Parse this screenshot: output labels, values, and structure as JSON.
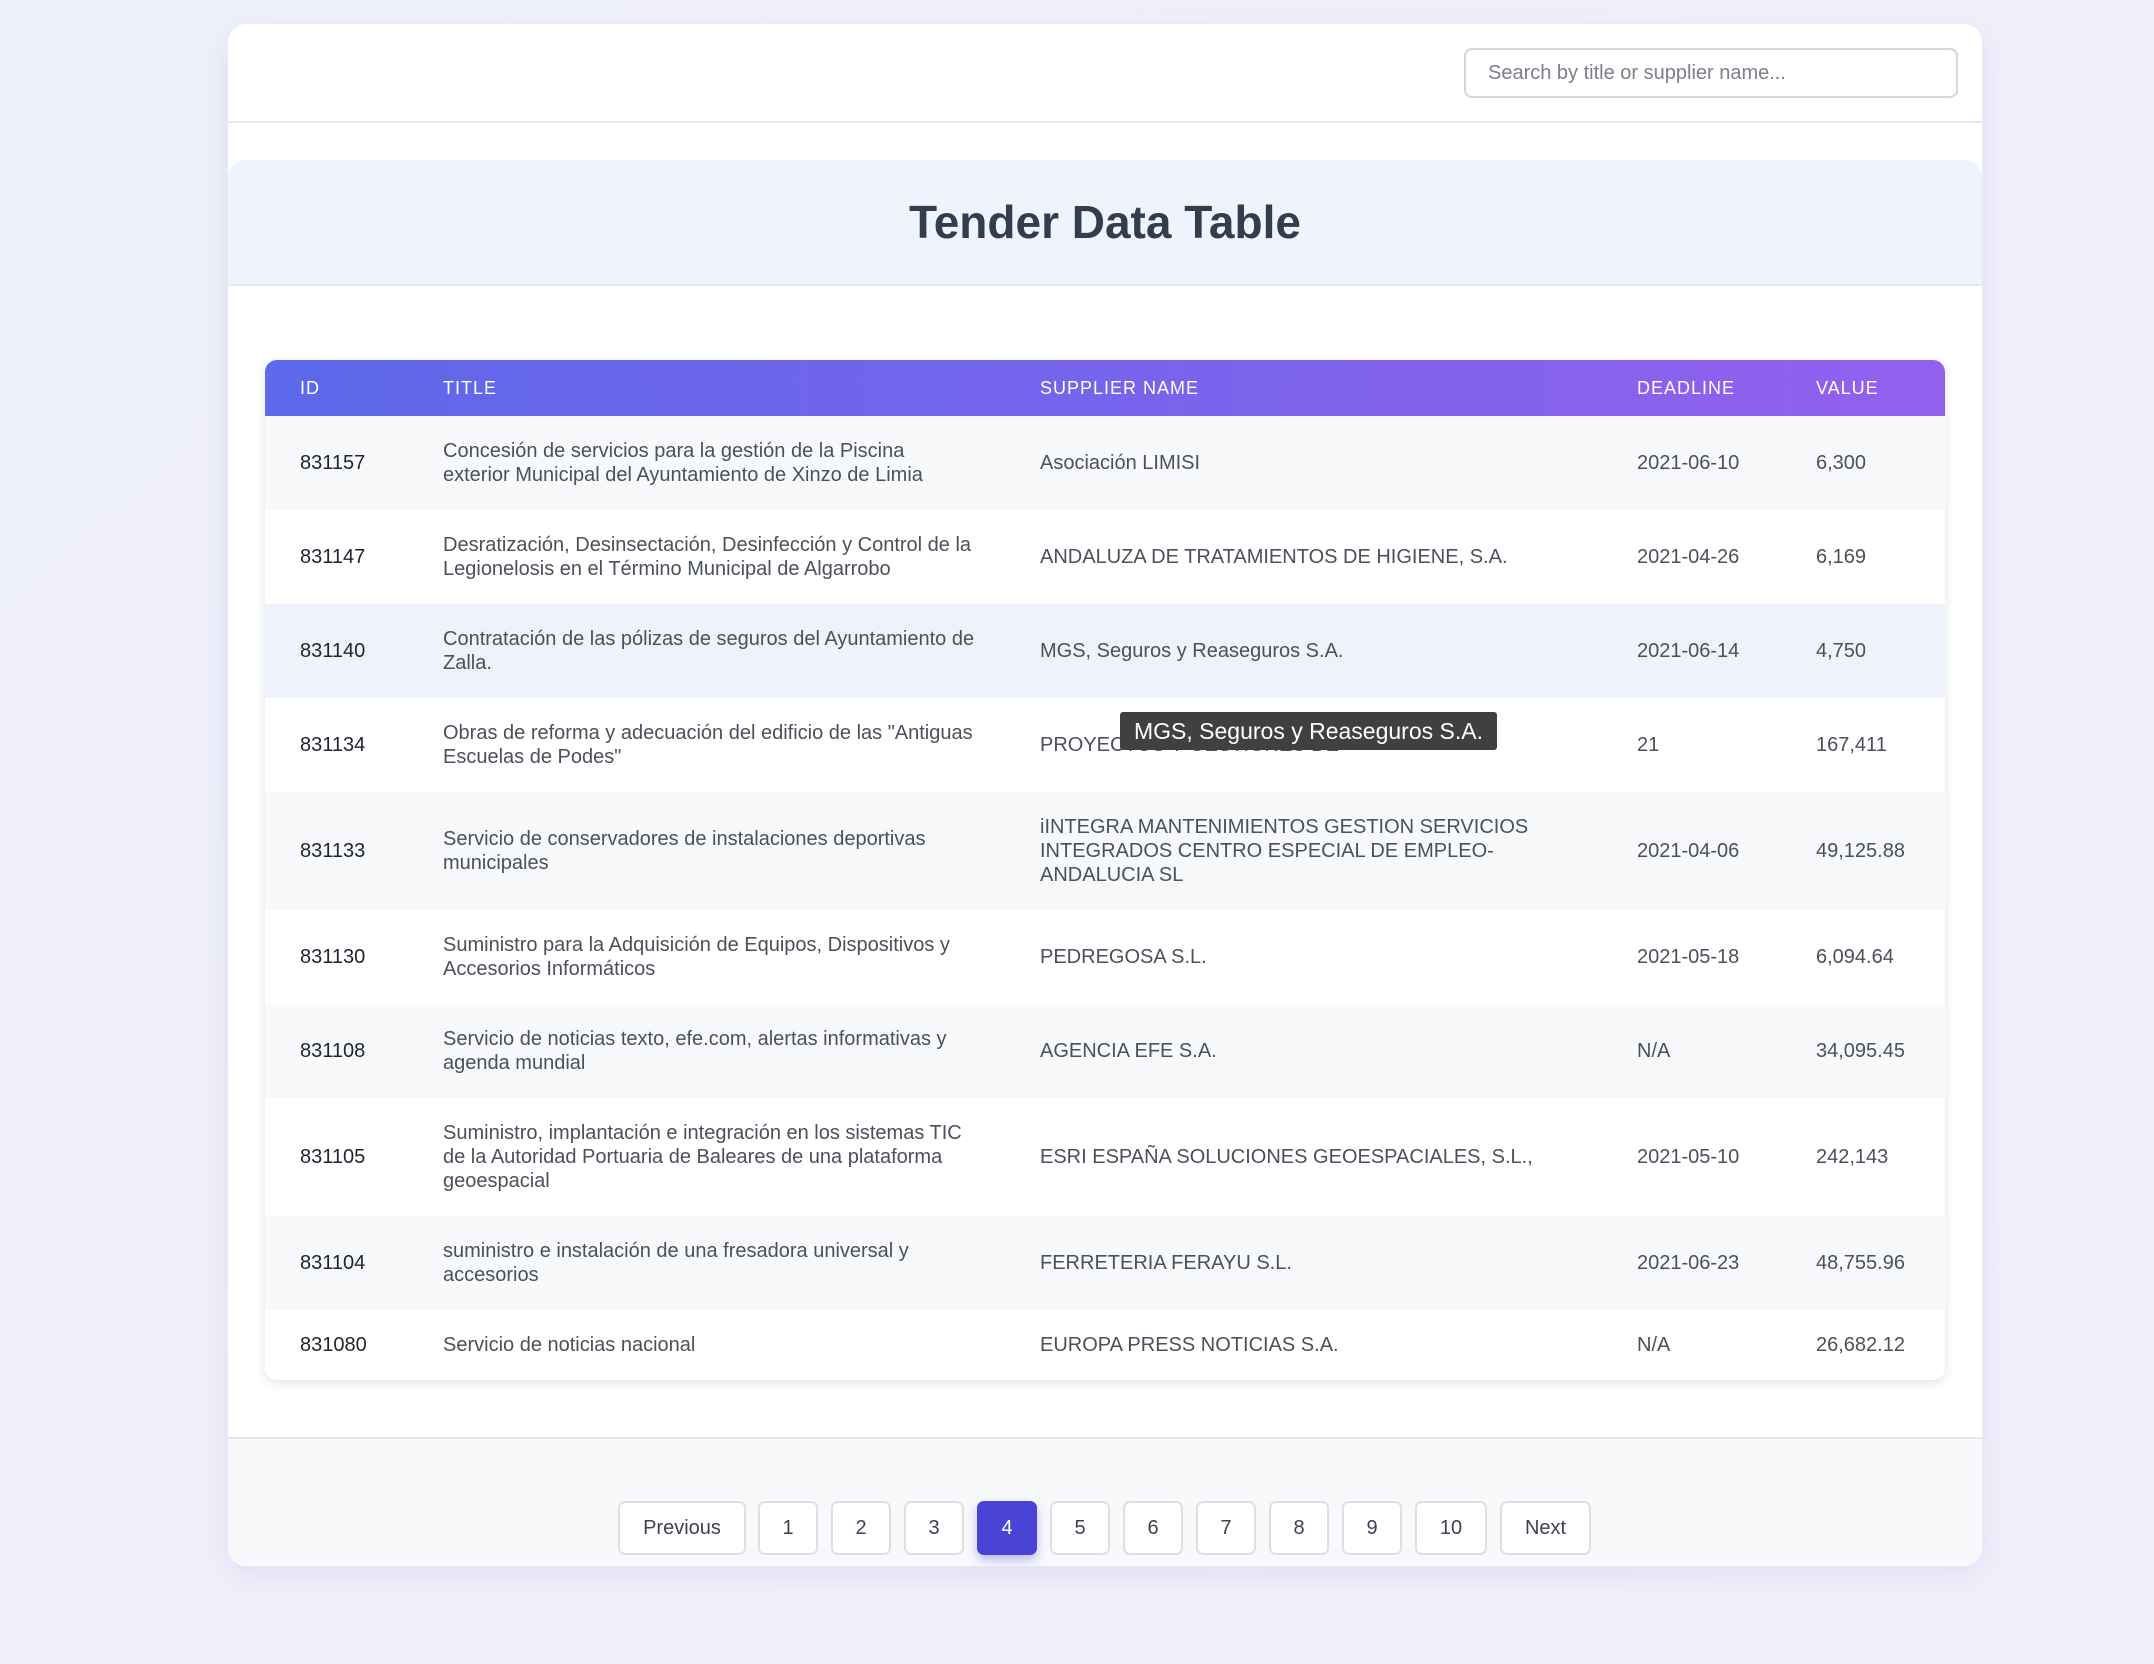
{
  "search": {
    "placeholder": "Search by title or supplier name..."
  },
  "page_title": "Tender Data Table",
  "table": {
    "headers": [
      "ID",
      "TITLE",
      "SUPPLIER NAME",
      "DEADLINE",
      "VALUE"
    ],
    "rows": [
      {
        "id": "831157",
        "title": "Concesión de servicios para la gestión de la Piscina exterior Municipal del Ayuntamiento de Xinzo de Limia",
        "supplier": "Asociación LIMISI",
        "deadline": "2021-06-10",
        "value": "6,300"
      },
      {
        "id": "831147",
        "title": "Desratización, Desinsectación, Desinfección y Control de la Legionelosis en el Término Municipal de Algarrobo",
        "supplier": "ANDALUZA DE TRATAMIENTOS DE HIGIENE, S.A.",
        "deadline": "2021-04-26",
        "value": "6,169"
      },
      {
        "id": "831140",
        "title": "Contratación de las pólizas de seguros del Ayuntamiento de Zalla.",
        "supplier": "MGS, Seguros y Reaseguros S.A.",
        "deadline": "2021-06-14",
        "value": "4,750"
      },
      {
        "id": "831134",
        "title": "Obras de reforma y adecuación del edificio de las \"Antiguas Escuelas de Podes\"",
        "supplier": "PROYECTOS Y GESTIONES DE",
        "deadline": "21",
        "value": "167,411"
      },
      {
        "id": "831133",
        "title": "Servicio de conservadores de instalaciones deportivas municipales",
        "supplier": "iINTEGRA MANTENIMIENTOS GESTION SERVICIOS INTEGRADOS CENTRO ESPECIAL DE EMPLEO-ANDALUCIA SL",
        "deadline": "2021-04-06",
        "value": "49,125.88"
      },
      {
        "id": "831130",
        "title": "Suministro para la Adquisición de Equipos, Dispositivos y Accesorios Informáticos",
        "supplier": "PEDREGOSA S.L.",
        "deadline": "2021-05-18",
        "value": "6,094.64"
      },
      {
        "id": "831108",
        "title": "Servicio de noticias texto, efe.com, alertas informativas y agenda mundial",
        "supplier": "AGENCIA EFE S.A.",
        "deadline": "N/A",
        "value": "34,095.45"
      },
      {
        "id": "831105",
        "title": "Suministro, implantación e integración en los sistemas TIC de la Autoridad Portuaria de Baleares de una plataforma geoespacial",
        "supplier": "ESRI ESPAÑA SOLUCIONES GEOESPACIALES, S.L.,",
        "deadline": "2021-05-10",
        "value": "242,143"
      },
      {
        "id": "831104",
        "title": "suministro e instalación de una fresadora universal y accesorios",
        "supplier": "FERRETERIA FERAYU S.L.",
        "deadline": "2021-06-23",
        "value": "48,755.96"
      },
      {
        "id": "831080",
        "title": "Servicio de noticias nacional",
        "supplier": "EUROPA PRESS NOTICIAS S.A.",
        "deadline": "N/A",
        "value": "26,682.12"
      }
    ]
  },
  "tooltip": "MGS, Seguros y Reaseguros S.A.",
  "pagination": {
    "previous": "Previous",
    "next": "Next",
    "pages": [
      "1",
      "2",
      "3",
      "4",
      "5",
      "6",
      "7",
      "8",
      "9",
      "10"
    ],
    "current": "4"
  },
  "colors": {
    "accent": "#4a43d6",
    "header_start": "#5d68ea",
    "header_end": "#9360ee"
  }
}
